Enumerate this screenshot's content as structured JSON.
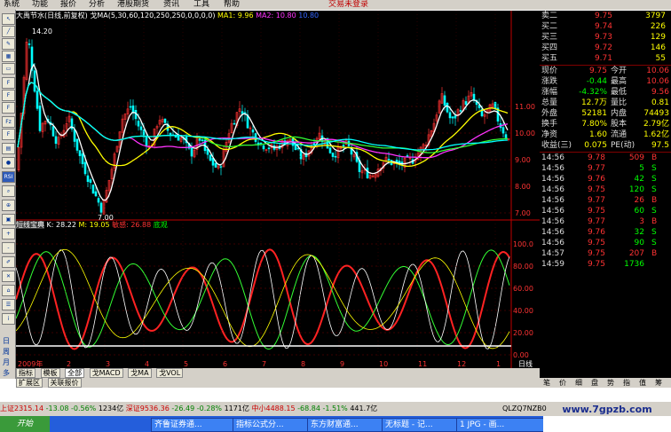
{
  "menubar": {
    "items": [
      "系统",
      "功能",
      "报价",
      "分析",
      "港股期货",
      "资讯",
      "工具",
      "帮助"
    ],
    "trade_status": "交易未登录"
  },
  "chart_header": {
    "title": "大禹节水(日线,前复权)",
    "ma_params": "戈MA(5,30,60,120,250,250,0,0,0,0)",
    "ma1": "MA1: 9.96",
    "ma2": "MA2: 10.80",
    "ma3": "10.80"
  },
  "price_labels": {
    "high": "14.20",
    "low": "7.00",
    "axis": [
      "11.00",
      "10.00",
      "9.00",
      "8.00",
      "7.00"
    ]
  },
  "indicator": {
    "name": "短线宝典",
    "k": "K: 28.22",
    "m": "M: 19.05",
    "extra": "敏感: 26.88",
    "tag": "底观",
    "axis": [
      "100.0",
      "80.00",
      "60.00",
      "40.00",
      "20.00",
      "0.00"
    ]
  },
  "xaxis": {
    "year": "2009年",
    "months": [
      "2",
      "3",
      "4",
      "5",
      "6",
      "7",
      "8",
      "9",
      "10",
      "11",
      "12",
      "1"
    ],
    "period": "日线"
  },
  "tabs_row1": [
    "指标",
    "模板",
    "全部",
    "戈MACD",
    "戈MA",
    "戈VOL"
  ],
  "tabs_row2": [
    "扩展区",
    "关联报价"
  ],
  "sidebar": {
    "labels": [
      "日",
      "周",
      "月",
      "多"
    ]
  },
  "quote": {
    "order_book": [
      {
        "label": "卖二",
        "price": "9.75",
        "vol": "3797"
      },
      {
        "label": "买二",
        "price": "9.74",
        "vol": "226"
      },
      {
        "label": "买三",
        "price": "9.73",
        "vol": "129"
      },
      {
        "label": "买四",
        "price": "9.72",
        "vol": "146"
      },
      {
        "label": "买五",
        "price": "9.71",
        "vol": "55"
      }
    ],
    "stats": [
      {
        "l1": "现价",
        "v1": "9.75",
        "l2": "今开",
        "v2": "10.06"
      },
      {
        "l1": "涨跌",
        "v1": "-0.44",
        "l2": "最高",
        "v2": "10.06"
      },
      {
        "l1": "涨幅",
        "v1": "-4.32%",
        "l2": "最低",
        "v2": "9.56"
      },
      {
        "l1": "总量",
        "v1": "12.7万",
        "l2": "量比",
        "v2": "0.81"
      },
      {
        "l1": "外盘",
        "v1": "52181",
        "l2": "内盘",
        "v2": "74493"
      },
      {
        "l1": "换手",
        "v1": "7.80%",
        "l2": "股本",
        "v2": "2.79亿"
      },
      {
        "l1": "净资",
        "v1": "1.60",
        "l2": "流通",
        "v2": "1.62亿"
      },
      {
        "l1": "收益(三)",
        "v1": "0.075",
        "l2": "PE(动)",
        "v2": "97.5"
      }
    ],
    "ticks": [
      {
        "time": "14:56",
        "price": "9.78",
        "vol": "509",
        "side": "B"
      },
      {
        "time": "14:56",
        "price": "9.77",
        "vol": "5",
        "side": "S"
      },
      {
        "time": "14:56",
        "price": "9.76",
        "vol": "42",
        "side": "S"
      },
      {
        "time": "14:56",
        "price": "9.75",
        "vol": "120",
        "side": "S"
      },
      {
        "time": "14:56",
        "price": "9.77",
        "vol": "26",
        "side": "B"
      },
      {
        "time": "14:56",
        "price": "9.75",
        "vol": "60",
        "side": "S"
      },
      {
        "time": "14:56",
        "price": "9.77",
        "vol": "3",
        "side": "B"
      },
      {
        "time": "14:56",
        "price": "9.76",
        "vol": "32",
        "side": "S"
      },
      {
        "time": "14:56",
        "price": "9.75",
        "vol": "90",
        "side": "S"
      },
      {
        "time": "14:57",
        "price": "9.75",
        "vol": "207",
        "side": "B"
      },
      {
        "time": "14:59",
        "price": "9.75",
        "vol": "1736",
        "side": ""
      }
    ],
    "bottom_tabs": [
      "笔",
      "价",
      "细",
      "盘",
      "势",
      "指",
      "值",
      "筹"
    ]
  },
  "status": {
    "sh": "上证2315.14",
    "sh_chg": "-13.08",
    "sh_pct": "-0.56%",
    "sh_amt": "1234亿",
    "sz": "深证9536.36",
    "sz_chg": "-26.49",
    "sz_pct": "-0.28%",
    "sz_amt": "1171亿",
    "zx": "中小4488.15",
    "zx_chg": "-68.84",
    "zx_pct": "-1.51%",
    "zx_amt": "441.7亿",
    "code": "QLZQ7NZB0"
  },
  "taskbar": {
    "start": "开始",
    "tasks": [
      "齐鲁证券通...",
      "指标公式分...",
      "东方财富通...",
      "无标题 - 记...",
      "1 JPG - 画..."
    ]
  },
  "watermark": "www.7gpzb.com",
  "colors": {
    "up": "#ff3333",
    "down": "#00ffff",
    "ma_white": "#ffffff",
    "ma_yellow": "#ffff00",
    "ma_magenta": "#ff33ff",
    "ma_green": "#33ff33",
    "ma_blue": "#3366ff"
  }
}
